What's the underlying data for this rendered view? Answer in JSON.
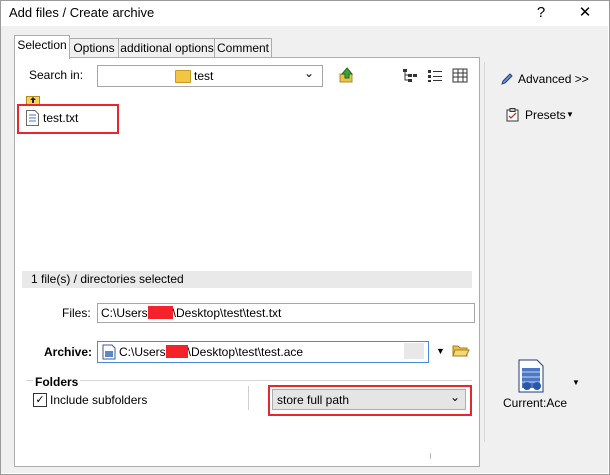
{
  "window": {
    "title": "Add files / Create archive",
    "help_label": "?",
    "close_label": "✕"
  },
  "tabs": [
    {
      "label": "Selection",
      "active": true
    },
    {
      "label": "Options",
      "active": false
    },
    {
      "label": "additional options",
      "active": false
    },
    {
      "label": "Comment",
      "active": false
    }
  ],
  "search": {
    "label": "Search in:",
    "value": "test",
    "dropdown_icon": "chevron-down-icon"
  },
  "toolbar_icons": [
    "folder-up-icon",
    "tree-view-icon",
    "list-view-icon",
    "details-view-icon"
  ],
  "files": [
    {
      "name": "test.txt",
      "icon": "text-file-icon",
      "selected": true
    }
  ],
  "status_text": "1 file(s) / directories selected",
  "files_field": {
    "label": "Files:",
    "value_prefix": "C:\\Users",
    "value_suffix": "\\Desktop\\test\\test.txt"
  },
  "archive_field": {
    "label": "Archive:",
    "value_prefix": "C:\\Users",
    "value_suffix": "\\Desktop\\test\\test.ace"
  },
  "folders": {
    "heading": "Folders",
    "include_subfolders_label": "Include subfolders",
    "include_subfolders_checked": true,
    "path_mode": "store full path"
  },
  "right_panel": {
    "advanced_label": "Advanced >>",
    "presets_label": "Presets",
    "current_label": "Current:Ace"
  },
  "colors": {
    "highlight_red": "#e8262c",
    "redacted_fill": "#f4232a",
    "tab_active_bg": "#ffffff",
    "panel_bg": "#f0f0f0"
  }
}
